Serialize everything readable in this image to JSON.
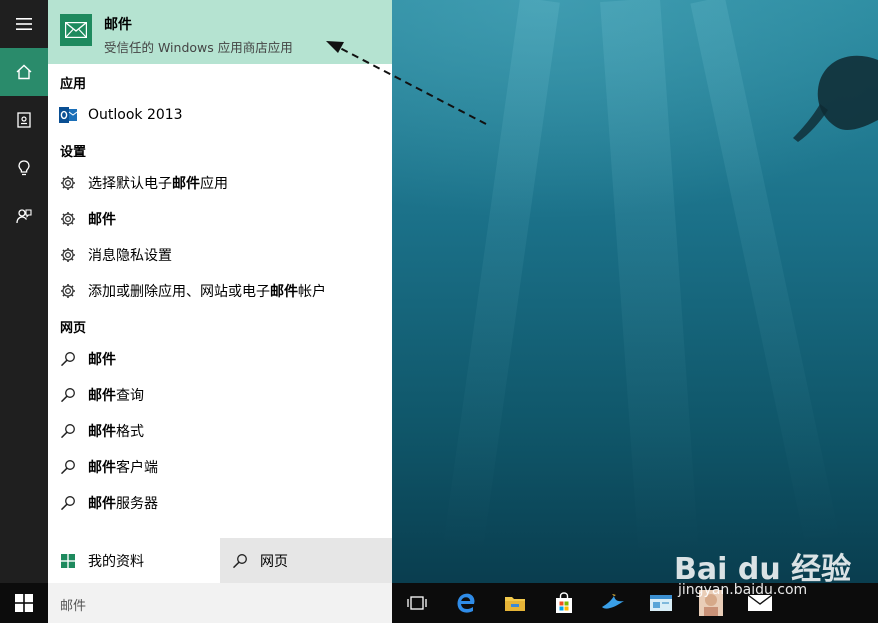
{
  "best_match": {
    "title": "邮件",
    "subtitle": "受信任的 Windows 应用商店应用"
  },
  "sections": {
    "apps": "应用",
    "settings": "设置",
    "web": "网页"
  },
  "apps": [
    {
      "label": "Outlook 2013",
      "icon": "outlook-icon"
    }
  ],
  "settings": [
    {
      "before": "选择默认电子",
      "bold": "邮件",
      "after": "应用"
    },
    {
      "before": "",
      "bold": "邮件",
      "after": ""
    },
    {
      "before": "消息隐私设置",
      "bold": "",
      "after": ""
    },
    {
      "before": "添加或删除应用、网站或电子",
      "bold": "邮件",
      "after": "帐户"
    }
  ],
  "web": [
    {
      "bold": "邮件",
      "after": ""
    },
    {
      "bold": "邮件",
      "after": "查询"
    },
    {
      "bold": "邮件",
      "after": "格式"
    },
    {
      "bold": "邮件",
      "after": "客户端"
    },
    {
      "bold": "邮件",
      "after": "服务器"
    }
  ],
  "bottom": {
    "my_stuff": "我的资料",
    "web": "网页"
  },
  "search": {
    "value": "邮件"
  },
  "watermark": {
    "logo": "Bai du 经验",
    "url": "jingyan.baidu.com"
  },
  "colors": {
    "accent": "#1e8a5e",
    "best_match_bg": "#b5e3d1",
    "rail_bg": "#1f1f1f",
    "home_bg": "#2a8b6b"
  }
}
